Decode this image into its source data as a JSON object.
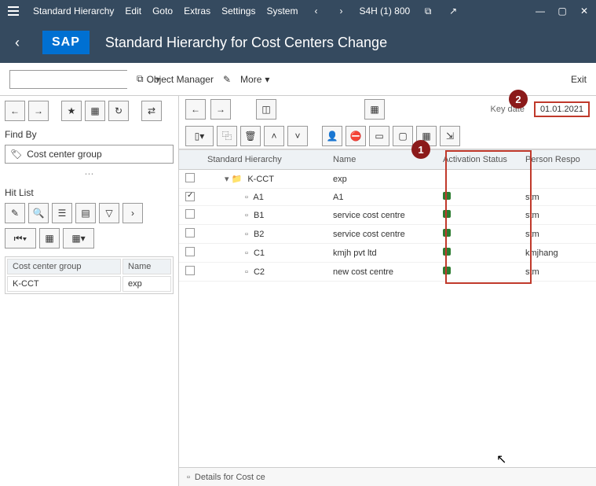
{
  "menu": {
    "items": [
      "Standard Hierarchy",
      "Edit",
      "Goto",
      "Extras",
      "Settings",
      "System"
    ],
    "session": "S4H (1) 800"
  },
  "header": {
    "logo": "SAP",
    "title": "Standard Hierarchy for Cost Centers Change"
  },
  "toolbar": {
    "object_manager": "Object Manager",
    "more": "More",
    "exit": "Exit"
  },
  "left": {
    "find_by": "Find By",
    "find_option": "Cost center group",
    "hit_list": "Hit List",
    "col_group": "Cost center group",
    "col_name": "Name",
    "row_group": "K-CCT",
    "row_name": "exp"
  },
  "rightbar": {
    "key_date_label": "Key date",
    "key_date": "01.01.2021"
  },
  "columns": {
    "hier": "Standard Hierarchy",
    "name": "Name",
    "act": "Activation Status",
    "resp": "Person Respo"
  },
  "rows": [
    {
      "sel": false,
      "lvl": 1,
      "type": "group",
      "code": "K-CCT",
      "name": "exp",
      "status": "",
      "resp": ""
    },
    {
      "sel": true,
      "lvl": 2,
      "type": "cc",
      "code": "A1",
      "name": "A1",
      "status": "g",
      "resp": "stm"
    },
    {
      "sel": false,
      "lvl": 2,
      "type": "cc",
      "code": "B1",
      "name": "service cost centre",
      "status": "g",
      "resp": "stm"
    },
    {
      "sel": false,
      "lvl": 2,
      "type": "cc",
      "code": "B2",
      "name": "service cost centre",
      "status": "g",
      "resp": "stm"
    },
    {
      "sel": false,
      "lvl": 2,
      "type": "cc",
      "code": "C1",
      "name": "kmjh pvt ltd",
      "status": "g",
      "resp": "kmjhang"
    },
    {
      "sel": false,
      "lvl": 2,
      "type": "cc",
      "code": "C2",
      "name": "new cost centre",
      "status": "g",
      "resp": "stm"
    }
  ],
  "callouts": {
    "c1": "1",
    "c2": "2"
  },
  "footer": {
    "details": "Details for Cost ce"
  }
}
